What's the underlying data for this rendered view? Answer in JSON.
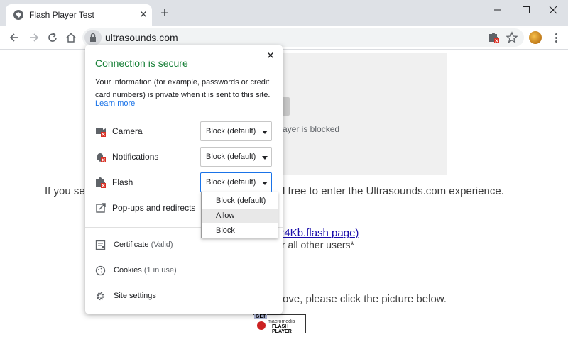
{
  "tab": {
    "title": "Flash Player Test",
    "close": "✕"
  },
  "new_tab": "+",
  "window": {
    "minimize": "minimize",
    "maximize": "maximize",
    "close": "close"
  },
  "address": {
    "url": "ultrasounds.com"
  },
  "page": {
    "plugin_blocked": "ayer is blocked",
    "line1_left": "If you se",
    "line1_right": "l free to enter the Ultrasounds.com experience.",
    "link": "24Kb.flash page)",
    "line2": "r all other users*",
    "line3": "ove, please click the picture below.",
    "badge": {
      "get": "GET",
      "macromedia": "macromedia",
      "flash": "FLASH",
      "player": "PLAYER"
    }
  },
  "popup": {
    "heading": "Connection is secure",
    "close": "✕",
    "description": "Your information (for example, passwords or credit card numbers) is private when it is sent to this site.",
    "learn_more": "Learn more",
    "permissions": [
      {
        "label": "Camera",
        "value": "Block (default)"
      },
      {
        "label": "Notifications",
        "value": "Block (default)"
      },
      {
        "label": "Flash",
        "value": "Block (default)"
      }
    ],
    "popups_label": "Pop-ups and redirects",
    "certificate": {
      "label": "Certificate",
      "sub": "(Valid)"
    },
    "cookies": {
      "label": "Cookies",
      "sub": "(1 in use)"
    },
    "site_settings": "Site settings"
  },
  "dropdown": {
    "options": [
      "Block (default)",
      "Allow",
      "Block"
    ],
    "highlighted": "Allow"
  },
  "colors": {
    "secure_green": "#188038",
    "link_blue": "#1a73e8",
    "tabbar": "#dee1e6"
  }
}
